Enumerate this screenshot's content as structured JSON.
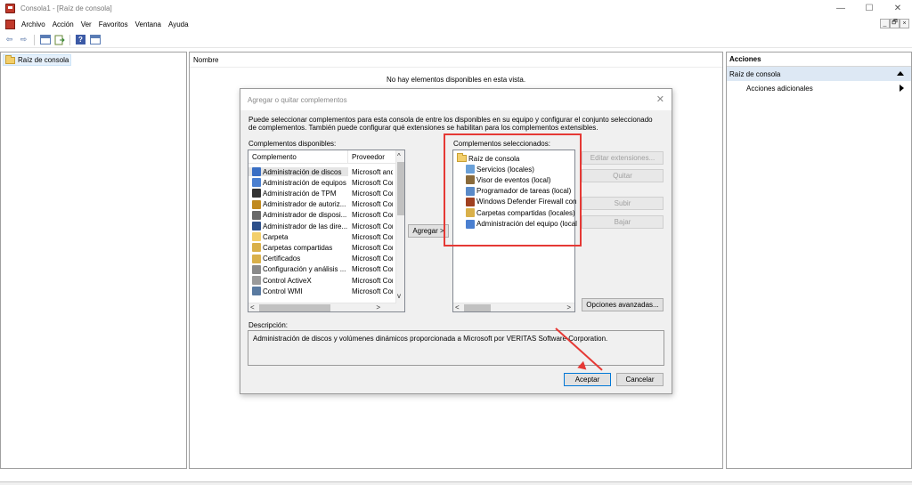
{
  "window": {
    "title": "Consola1 - [Raíz de consola]",
    "controls": {
      "minimize": "—",
      "maximize": "☐",
      "close": "✕"
    },
    "mdi_controls": [
      "_",
      "🗗",
      "×"
    ]
  },
  "menu": [
    "Archivo",
    "Acción",
    "Ver",
    "Favoritos",
    "Ventana",
    "Ayuda"
  ],
  "toolbar": {
    "back": "⇦",
    "forward": "⇨"
  },
  "left_panel": {
    "tree_root": "Raíz de consola"
  },
  "center_panel": {
    "column": "Nombre",
    "empty_message": "No hay elementos disponibles en esta vista."
  },
  "right_panel": {
    "title": "Acciones",
    "section": "Raíz de consola",
    "item": "Acciones adicionales"
  },
  "dialog": {
    "title": "Agregar o quitar complementos",
    "close": "✕",
    "description": "Puede seleccionar complementos para esta consola de entre los disponibles en su equipo y configurar el conjunto seleccionado de complementos. También puede configurar qué extensiones se habilitan para los complementos extensibles.",
    "available_label": "Complementos disponibles:",
    "selected_label": "Complementos seleccionados:",
    "columns": {
      "snapin": "Complemento",
      "vendor": "Proveedor"
    },
    "available": [
      {
        "name": "Administración de discos",
        "vendor": "Microsoft and",
        "icon": "#3a6fc4"
      },
      {
        "name": "Administración de equipos",
        "vendor": "Microsoft Cor",
        "icon": "#4a7fd0"
      },
      {
        "name": "Administración de TPM",
        "vendor": "Microsoft Cor",
        "icon": "#333333"
      },
      {
        "name": "Administrador de autoriz...",
        "vendor": "Microsoft Cor",
        "icon": "#c08a20"
      },
      {
        "name": "Administrador de disposi...",
        "vendor": "Microsoft Cor",
        "icon": "#6a6a6a"
      },
      {
        "name": "Administrador de las dire...",
        "vendor": "Microsoft Cor",
        "icon": "#2c4f8a"
      },
      {
        "name": "Carpeta",
        "vendor": "Microsoft Cor",
        "icon": "#f3cf6b"
      },
      {
        "name": "Carpetas compartidas",
        "vendor": "Microsoft Cor",
        "icon": "#d9b04a"
      },
      {
        "name": "Certificados",
        "vendor": "Microsoft Cor",
        "icon": "#d9b04a"
      },
      {
        "name": "Configuración y análisis ...",
        "vendor": "Microsoft Cor",
        "icon": "#8a8a8a"
      },
      {
        "name": "Control ActiveX",
        "vendor": "Microsoft Cor",
        "icon": "#9a9a9a"
      },
      {
        "name": "Control WMI",
        "vendor": "Microsoft Cor",
        "icon": "#5a7aa0"
      }
    ],
    "selected_root": "Raíz de consola",
    "selected": [
      {
        "name": "Servicios (locales)",
        "icon": "#6aa0d8"
      },
      {
        "name": "Visor de eventos (local)",
        "icon": "#8a6a3a"
      },
      {
        "name": "Programador de tareas (local)",
        "icon": "#5a8ac8"
      },
      {
        "name": "Windows Defender Firewall con",
        "icon": "#a04020"
      },
      {
        "name": "Carpetas compartidas (locales)",
        "icon": "#d9b04a"
      },
      {
        "name": "Administración del equipo (local",
        "icon": "#4a7fd0"
      }
    ],
    "buttons": {
      "add": "Agregar >",
      "edit_extensions": "Editar extensiones...",
      "remove": "Quitar",
      "move_up": "Subir",
      "move_down": "Bajar",
      "advanced": "Opciones avanzadas...",
      "ok": "Aceptar",
      "cancel": "Cancelar"
    },
    "description_label": "Descripción:",
    "description_text": "Administración de discos y volúmenes dinámicos proporcionada a Microsoft por VERITAS Software Corporation."
  },
  "annotation_color": "#e53935"
}
